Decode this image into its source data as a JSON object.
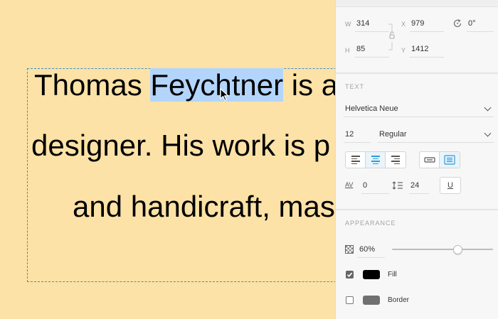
{
  "canvas": {
    "line1_before": "Thomas ",
    "line1_selected": "Feychtner",
    "line1_after": " is a",
    "line2": "designer. His work is p",
    "line3": "and handicraft, mas"
  },
  "geometry": {
    "w_label": "W",
    "w_value": "314",
    "x_label": "X",
    "x_value": "979",
    "rotation_value": "0°",
    "h_label": "H",
    "h_value": "85",
    "y_label": "Y",
    "y_value": "1412"
  },
  "text_section": {
    "title": "TEXT",
    "font_family": "Helvetica Neue",
    "font_size": "12",
    "font_weight": "Regular",
    "kerning_label": "AV",
    "kerning_value": "0",
    "line_height_value": "24",
    "underline_glyph": "U"
  },
  "appearance": {
    "title": "APPEARANCE",
    "opacity_value": "60%",
    "opacity_level": 0.6,
    "fill_label": "Fill",
    "fill_checked": true,
    "fill_color": "#000000",
    "border_label": "Border",
    "border_checked": false,
    "border_color": "#707070"
  },
  "colors": {
    "canvas_bg": "#fce2a6",
    "selection": "#b3d5fc",
    "accent": "#2e9bd6"
  }
}
